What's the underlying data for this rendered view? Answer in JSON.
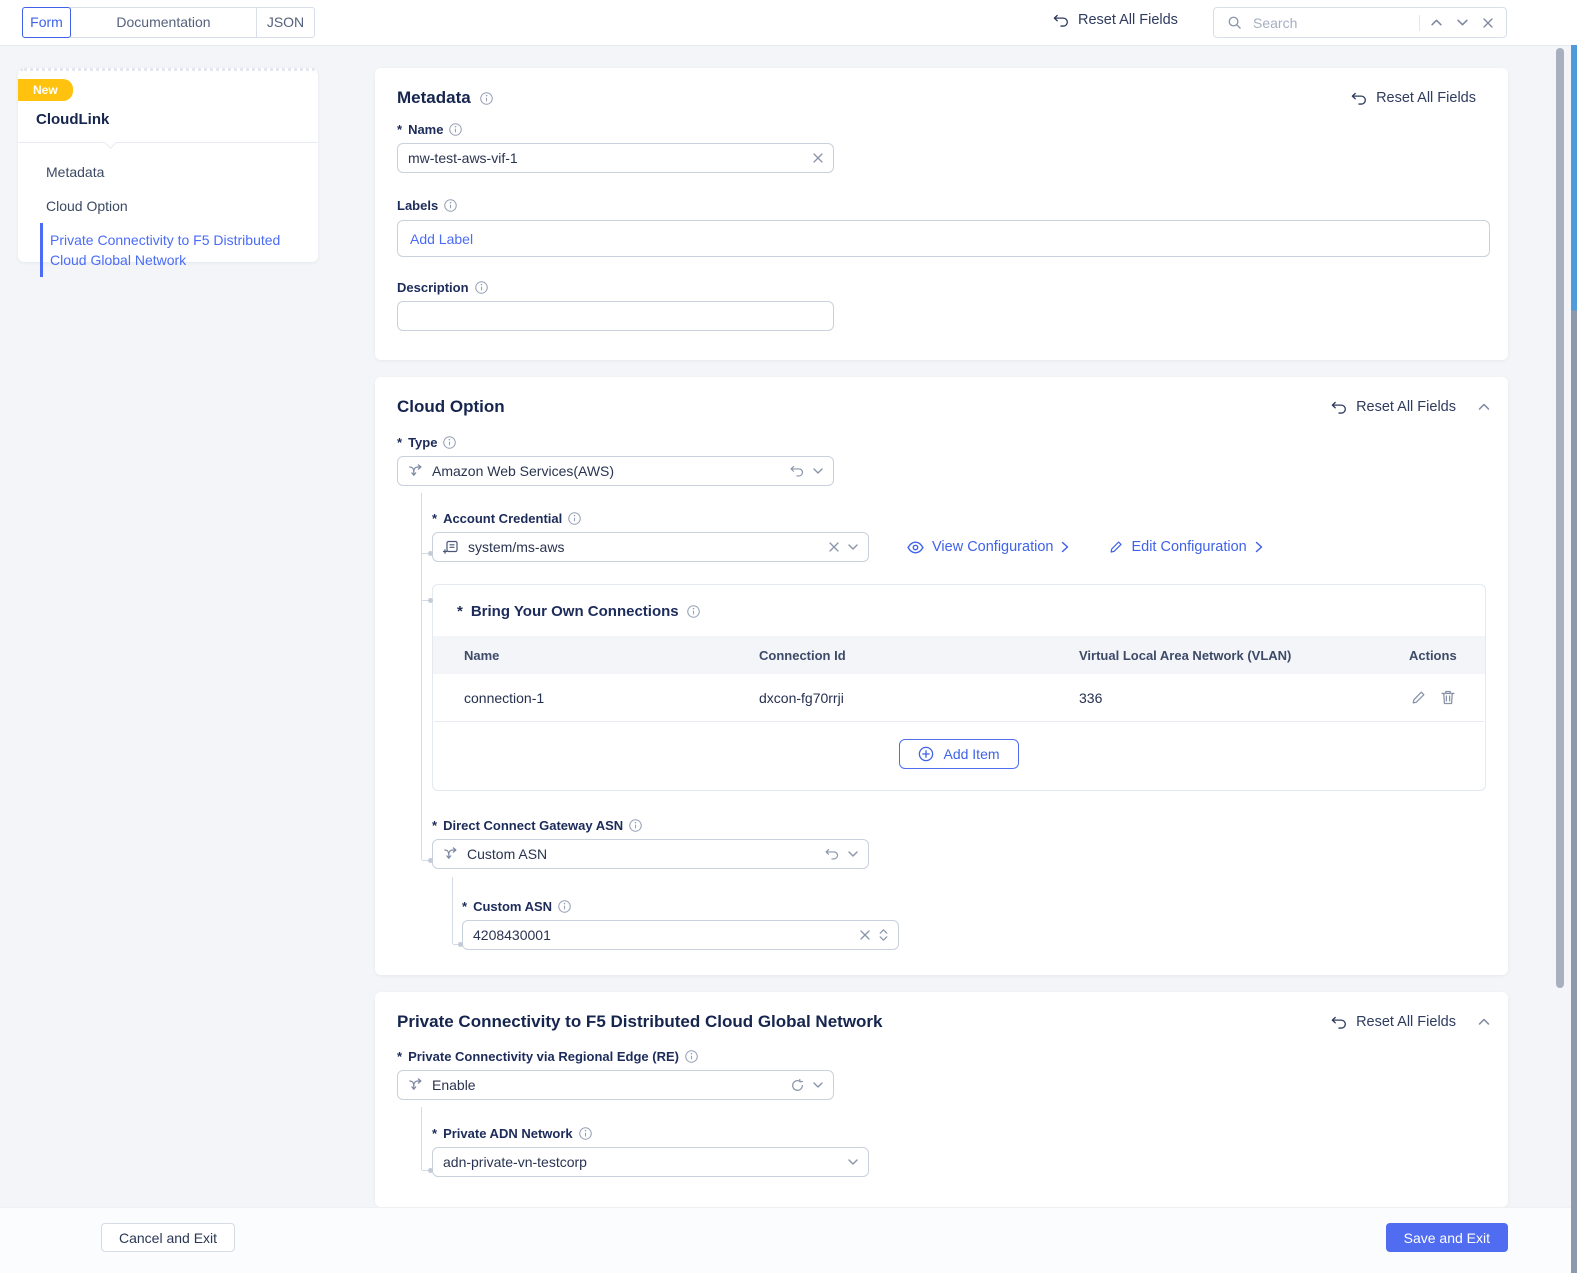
{
  "ui": {
    "required_marker": "*"
  },
  "topbar": {
    "tabs": [
      {
        "label": "Form"
      },
      {
        "label": "Documentation"
      },
      {
        "label": "JSON"
      }
    ],
    "reset_all_label": "Reset All Fields",
    "search": {
      "placeholder": "Search"
    }
  },
  "sidebar": {
    "badge": "New",
    "title": "CloudLink",
    "items": [
      {
        "label": "Metadata"
      },
      {
        "label": "Cloud Option"
      },
      {
        "label": "Private Connectivity to F5 Distributed Cloud Global Network"
      }
    ]
  },
  "sections": {
    "metadata": {
      "title": "Metadata",
      "reset_label": "Reset All Fields",
      "name_label": "Name",
      "name_value": "mw-test-aws-vif-1",
      "labels_label": "Labels",
      "add_label": "Add Label",
      "description_label": "Description",
      "description_value": ""
    },
    "cloud_option": {
      "title": "Cloud Option",
      "reset_label": "Reset All Fields",
      "type_label": "Type",
      "type_value": "Amazon Web Services(AWS)",
      "account_credential_label": "Account Credential",
      "account_credential_value": "system/ms-aws",
      "view_configuration_label": "View Configuration",
      "edit_configuration_label": "Edit Configuration",
      "byoc": {
        "title": "Bring Your Own Connections",
        "columns": [
          "Name",
          "Connection Id",
          "Virtual Local Area Network (VLAN)",
          "Actions"
        ],
        "rows": [
          {
            "name": "connection-1",
            "connection_id": "dxcon-fg70rrji",
            "vlan": "336"
          }
        ],
        "add_item_label": "Add Item"
      },
      "dcg_asn_label": "Direct Connect Gateway ASN",
      "dcg_asn_value": "Custom ASN",
      "custom_asn_label": "Custom ASN",
      "custom_asn_value": "4208430001"
    },
    "private_connectivity": {
      "title": "Private Connectivity to F5 Distributed Cloud Global Network",
      "reset_label": "Reset All Fields",
      "re_label": "Private Connectivity via Regional Edge (RE)",
      "re_value": "Enable",
      "adn_label": "Private ADN Network",
      "adn_value": "adn-private-vn-testcorp"
    }
  },
  "footer": {
    "cancel_label": "Cancel and Exit",
    "save_label": "Save and Exit"
  },
  "colors": {
    "accent": "#3F62E8",
    "badge_yellow": "#FFC20E",
    "save_button": "#506CF0",
    "navy": "#16254E"
  }
}
